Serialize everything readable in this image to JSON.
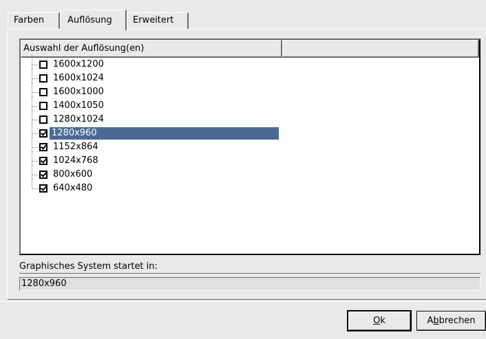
{
  "tabs": [
    {
      "label": "Farben",
      "active": false
    },
    {
      "label": "Auflösung",
      "active": true
    },
    {
      "label": "Erweitert",
      "active": false
    }
  ],
  "list": {
    "column_header": "Auswahl der Auflösung(en)",
    "items": [
      {
        "label": "1600x1200",
        "checked": false,
        "selected": false
      },
      {
        "label": "1600x1024",
        "checked": false,
        "selected": false
      },
      {
        "label": "1600x1000",
        "checked": false,
        "selected": false
      },
      {
        "label": "1400x1050",
        "checked": false,
        "selected": false
      },
      {
        "label": "1280x1024",
        "checked": false,
        "selected": false
      },
      {
        "label": "1280x960",
        "checked": true,
        "selected": true
      },
      {
        "label": "1152x864",
        "checked": true,
        "selected": false
      },
      {
        "label": "1024x768",
        "checked": true,
        "selected": false
      },
      {
        "label": "800x600",
        "checked": true,
        "selected": false
      },
      {
        "label": "640x480",
        "checked": true,
        "selected": false
      }
    ]
  },
  "status": {
    "label": "Graphisches System startet in:",
    "value": "1280x960"
  },
  "buttons": {
    "ok": {
      "pre": "",
      "mnemonic": "O",
      "post": "k"
    },
    "cancel": {
      "pre": "A",
      "mnemonic": "b",
      "post": "brechen"
    }
  },
  "colors": {
    "selection": "#4a6a95",
    "background": "#e9e9e9"
  }
}
